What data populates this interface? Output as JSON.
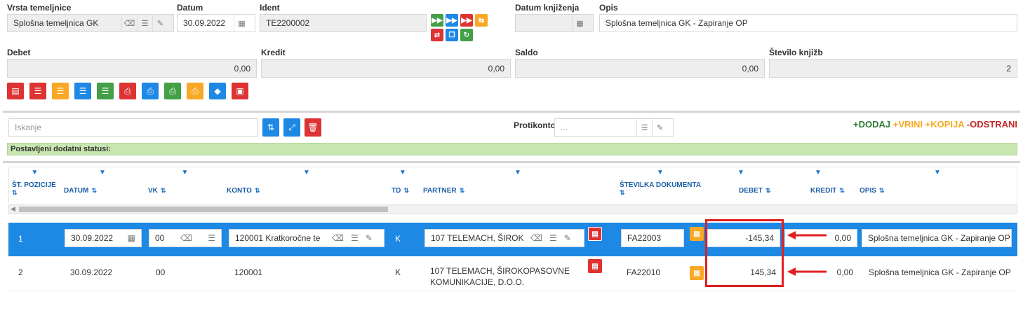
{
  "header": {
    "vrsta_label": "Vrsta temeljnice",
    "vrsta_value": "Splošna temeljnica GK",
    "datum_label": "Datum",
    "datum_value": "30.09.2022",
    "ident_label": "Ident",
    "ident_value": "TE2200002",
    "datum_knjizenja_label": "Datum knjiženja",
    "datum_knjizenja_value": "",
    "opis_label": "Opis",
    "opis_value": "Splošna temeljnica GK - Zapiranje OP"
  },
  "totals": {
    "debet_label": "Debet",
    "debet_value": "0,00",
    "kredit_label": "Kredit",
    "kredit_value": "0,00",
    "saldo_label": "Saldo",
    "saldo_value": "0,00",
    "stevilo_label": "Število knjižb",
    "stevilo_value": "2"
  },
  "search": {
    "placeholder": "Iskanje",
    "protikonto_label": "Protikonto",
    "protikonto_placeholder": "...",
    "add_label": "+DODAJ",
    "insert_label": "+VRINI",
    "copy_label": "+KOPIJA",
    "remove_label": "-ODSTRANI",
    "status_text": "Postavljeni dodatni statusi:"
  },
  "columns": [
    "ŠT. POZICIJE",
    "DATUM",
    "VK",
    "KONTO",
    "TD",
    "PARTNER",
    "ŠTEVILKA DOKUMENTA",
    "DEBET",
    "KREDIT",
    "OPIS"
  ],
  "rows": [
    {
      "pos": "1",
      "datum": "30.09.2022",
      "vk": "00",
      "konto": "120001 Kratkoročne te",
      "td": "K",
      "partner": "107 TELEMACH, ŠIROK",
      "dokument": "FA22003",
      "debet": "-145,34",
      "kredit": "0,00",
      "opis": "Splošna temeljnica GK - Zapiranje OP"
    },
    {
      "pos": "2",
      "datum": "30.09.2022",
      "vk": "00",
      "konto": "120001",
      "td": "K",
      "partner": "107 TELEMACH, ŠIROKOPASOVNE KOMUNIKACIJE, D.O.O.",
      "dokument": "FA22010",
      "debet": "145,34",
      "kredit": "0,00",
      "opis": "Splošna temeljnica GK - Zapiranje OP"
    }
  ],
  "colors": {
    "selected_row": "#1e88e5",
    "status_bar": "#c8e6b0",
    "annotation": "#e02020"
  }
}
